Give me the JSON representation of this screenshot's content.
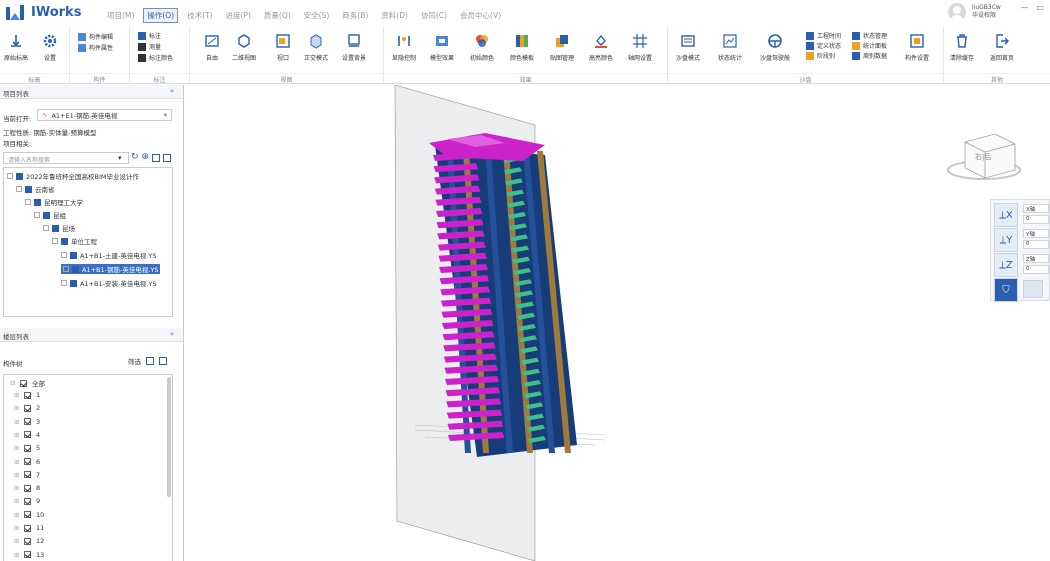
{
  "app": {
    "title": "IWorks"
  },
  "menu": [
    {
      "label": "项目(M)",
      "active": false
    },
    {
      "label": "操作(O)",
      "active": true
    },
    {
      "label": "技术(T)",
      "active": false
    },
    {
      "label": "进度(P)",
      "active": false
    },
    {
      "label": "质量(Q)",
      "active": false
    },
    {
      "label": "安全(S)",
      "active": false
    },
    {
      "label": "商务(B)",
      "active": false
    },
    {
      "label": "资料(D)",
      "active": false
    },
    {
      "label": "协同(C)",
      "active": false
    },
    {
      "label": "会员中心(V)",
      "active": false
    }
  ],
  "user": {
    "name": "liuGB3Cw",
    "role": "毕设权限"
  },
  "ribbon": {
    "groups": [
      {
        "label": "标高"
      },
      {
        "label": "构件"
      },
      {
        "label": "标注"
      },
      {
        "label": "视图"
      },
      {
        "label": "效果"
      },
      {
        "label": "沙盘"
      },
      {
        "label": "其他"
      }
    ],
    "buttons": {
      "origin": "原始标高",
      "settings": "设置",
      "comp_edit": "构件编辑",
      "comp_attr": "构件属性",
      "annot": "标注",
      "measure": "测量",
      "annot_color": "标注颜色",
      "free": "自由",
      "view2d": "二维视图",
      "window": "视口",
      "ortho": "正交模式",
      "bg": "设置背景",
      "explode": "显隐控制",
      "model_effect": "模型效果",
      "init_color": "初始颜色",
      "color_template": "颜色模板",
      "map_manage": "贴图管理",
      "highlight_color": "高亮颜色",
      "grid_set": "轴网设置",
      "sandbox_mode": "沙盘模式",
      "status_stat": "状态统计",
      "sandbox_roam": "沙盘驾驶舱",
      "work_time": "工程时间",
      "define_state": "定义状态",
      "phase": "阶段别",
      "state_manage": "状态管理",
      "stat_panel": "统计面板",
      "week_data": "周别数据",
      "comp_setting": "构件设置",
      "clear_cache": "清除缓存",
      "back_home": "返回首页"
    }
  },
  "project_panel": {
    "title": "项目列表",
    "current_label": "当前打开:",
    "current_value": "A1+E1-钢筋-英佳电视",
    "project_type": "工程性质: 钢筋-实体量-预算模型",
    "project_status": "项目相关:",
    "search_placeholder": "请输入名称搜索",
    "tree": [
      {
        "label": "2022年鲁班杯全国高校BIM毕业设计作",
        "level": 0
      },
      {
        "label": "云南省",
        "level": 1
      },
      {
        "label": "昆明理工大学",
        "level": 2
      },
      {
        "label": "昆组",
        "level": 3
      },
      {
        "label": "昆场",
        "level": 4
      },
      {
        "label": "单位工程",
        "level": 5
      },
      {
        "label": "A1+B1-土建-英佳电视.YS",
        "level": 6
      },
      {
        "label": "A1+B1-钢筋-英佳电视.YS",
        "level": 6,
        "selected": true
      },
      {
        "label": "A1+B1-安装-英佳电视.YS",
        "level": 6
      }
    ]
  },
  "floor_panel": {
    "title": "楼层列表",
    "sub_label": "构件树",
    "filter_label": "筛选",
    "all_label": "全部",
    "floors": [
      "1",
      "2",
      "3",
      "4",
      "5",
      "6",
      "7",
      "8",
      "9",
      "10",
      "11",
      "12",
      "13"
    ]
  },
  "viewcube": {
    "face_label": "右|后"
  },
  "axis_panel": {
    "x_axis": "X轴",
    "y_axis": "Y轴",
    "z_axis": "Z轴",
    "x_val": "0",
    "y_val": "0",
    "z_val": "0"
  }
}
